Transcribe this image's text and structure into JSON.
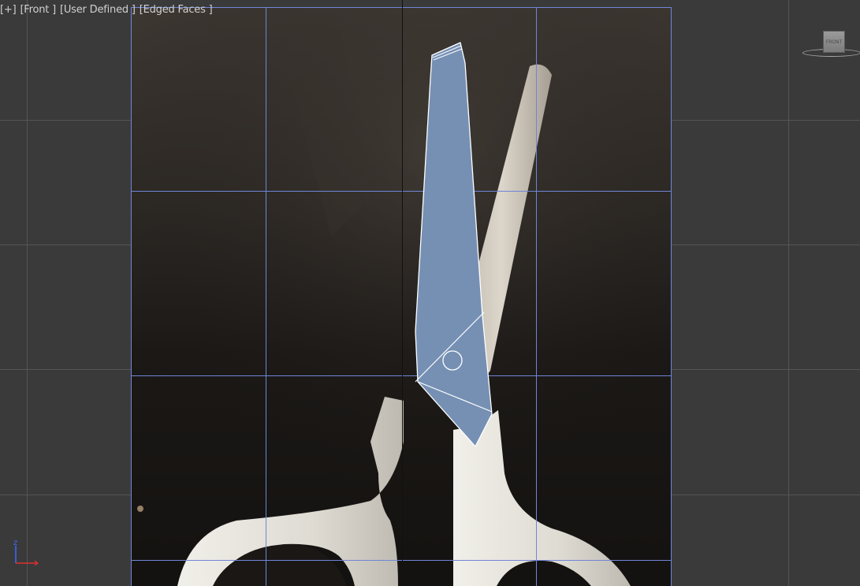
{
  "viewport": {
    "label": {
      "menu": "[+]",
      "view": "[Front ]",
      "shading": "[User Defined ]",
      "display": "[Edged Faces ]"
    },
    "viewcube": {
      "face_label": "FRONT"
    },
    "axis_tripod": {
      "z_label": "z",
      "z_color": "#3a6cff",
      "x_color": "#e03030"
    },
    "colors": {
      "background": "#3a3a3a",
      "grid_line": "#555555",
      "frame_grid_line": "#6f86d8",
      "blade_fill": "#7690b4",
      "blade_edge": "#ffffff",
      "handle": "#e2e0da"
    }
  }
}
